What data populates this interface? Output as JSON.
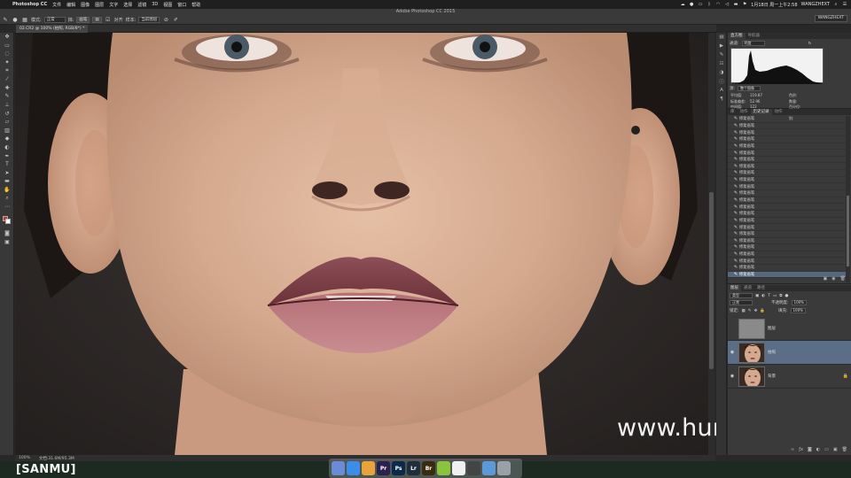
{
  "menubar": {
    "apple": "",
    "app_name": "Photoshop CC",
    "items": [
      "文件",
      "编辑",
      "图像",
      "图层",
      "文字",
      "选择",
      "滤镜",
      "3D",
      "视图",
      "窗口",
      "帮助"
    ],
    "datetime": "1月18日 周一上午2:58",
    "user": "WANGZHEXT"
  },
  "options_bar": {
    "window_title": "Adobe Photoshop CC 2015",
    "mode_label": "模式:",
    "mode_value": "正常",
    "erase_label": "抹:",
    "erase_value": "画笔",
    "sample_label": "样本:",
    "sample_value": "当前图层",
    "align_label": "对齐",
    "workspace": "WANGZHEXT"
  },
  "document": {
    "tab_title": "02.CR2 @ 100% (拍照, RGB/8*) *"
  },
  "status_bar": {
    "zoom": "100%",
    "doc_size": "文档:31.6M/95.3M"
  },
  "histogram": {
    "tabs": [
      "直方图",
      "导航器"
    ],
    "channel_label": "通道:",
    "channel_value": "明度",
    "source_label": "源:",
    "source_value": "整个图像",
    "stats": [
      {
        "label": "平均值:",
        "value": "119.87",
        "label2": "色阶:",
        "value2": ""
      },
      {
        "label": "标准偏差:",
        "value": "52.96",
        "label2": "数量:",
        "value2": ""
      },
      {
        "label": "中间值:",
        "value": "122",
        "label2": "百分位:",
        "value2": ""
      },
      {
        "label": "像素:",
        "value": "173724",
        "label2": "高速缓存级别:",
        "value2": "4"
      }
    ]
  },
  "history": {
    "tabs": [
      "库",
      "动作",
      "历史记录",
      "动作"
    ],
    "item_label": "修复画笔",
    "count": 24
  },
  "layers": {
    "tabs": [
      "图层",
      "通道",
      "路径"
    ],
    "filter_value": "类型",
    "blend_value": "正常",
    "opacity_label": "不透明度:",
    "opacity_value": "100%",
    "lock_label": "锁定:",
    "fill_label": "填充:",
    "fill_value": "100%",
    "items": [
      {
        "name": "图层",
        "type": "gray",
        "visible": false,
        "active": false,
        "locked": false
      },
      {
        "name": "拍照",
        "type": "face",
        "visible": true,
        "active": true,
        "locked": false
      },
      {
        "name": "背景",
        "type": "face",
        "visible": true,
        "active": false,
        "locked": true
      }
    ]
  },
  "watermark": "www.hunls.com",
  "corner_badge": "[SANMU]",
  "dock": {
    "apps": [
      {
        "label": "",
        "color": "#6a8bd8",
        "icon": "finder-icon"
      },
      {
        "label": "",
        "color": "#3b8ee8",
        "icon": "safari-icon"
      },
      {
        "label": "",
        "color": "#e8a33b",
        "icon": "chrome-icon"
      },
      {
        "label": "Pr",
        "color": "#2d1f4e",
        "icon": "premiere-icon"
      },
      {
        "label": "Ps",
        "color": "#0b2a4a",
        "icon": "photoshop-icon"
      },
      {
        "label": "Lr",
        "color": "#1f2e3a",
        "icon": "lightroom-icon"
      },
      {
        "label": "Br",
        "color": "#3a2a10",
        "icon": "bridge-icon"
      },
      {
        "label": "",
        "color": "#8ac43b",
        "icon": "app-icon"
      },
      {
        "label": "",
        "color": "#f0f0f0",
        "icon": "qq-icon"
      },
      {
        "label": "",
        "color": "#444444",
        "icon": "clapper-icon"
      },
      {
        "label": "",
        "color": "#5a9ad8",
        "icon": "folder-icon"
      },
      {
        "label": "",
        "color": "#9aa0a8",
        "icon": "trash-icon"
      }
    ]
  },
  "colors": {
    "active_row": "#56687e",
    "foreground_swatch": "#c0392b",
    "background_swatch": "#ffffff"
  }
}
